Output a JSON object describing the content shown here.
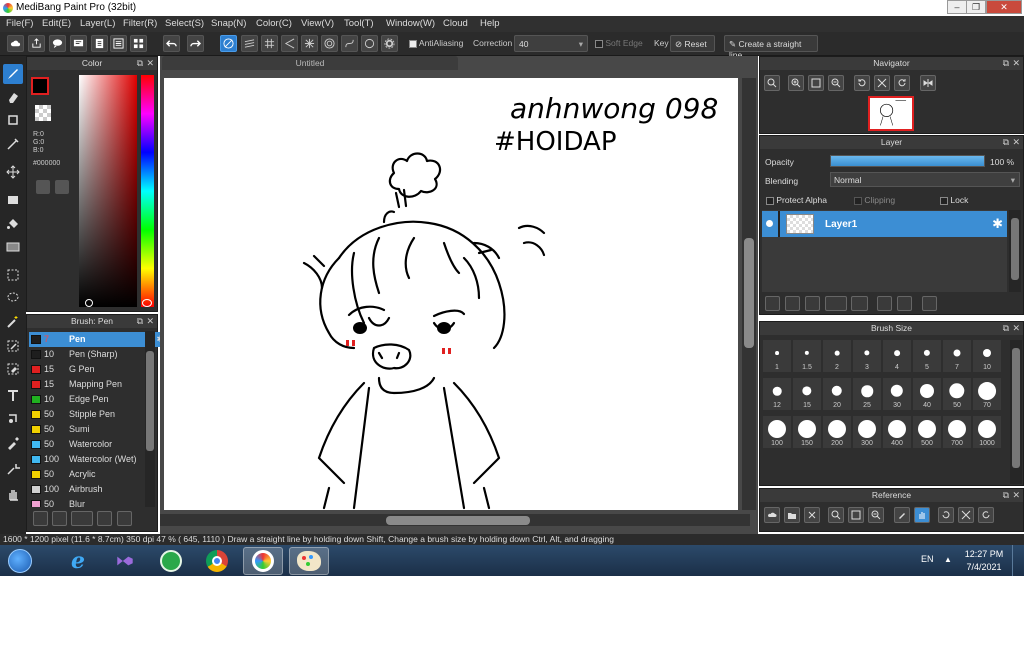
{
  "window": {
    "title": "MediBang Paint Pro (32bit)",
    "min": "–",
    "max": "❐",
    "close": "✕"
  },
  "menu": [
    "File(F)",
    "Edit(E)",
    "Layer(L)",
    "Filter(R)",
    "Select(S)",
    "Snap(N)",
    "Color(C)",
    "View(V)",
    "Tool(T)",
    "Window(W)",
    "Cloud",
    "Help"
  ],
  "toolbar": {
    "antialiasing": "AntiAliasing",
    "correction_label": "Correction",
    "correction_value": "40",
    "soft_edge": "Soft Edge",
    "key": "Key",
    "reset": "Reset",
    "straight_line": "Create a straight line"
  },
  "color_panel": {
    "title": "Color",
    "r": "R:0",
    "g": "G:0",
    "b": "B:0",
    "hex": "#000000",
    "primary_color": "#000000"
  },
  "brush_panel": {
    "title": "Brush: Pen",
    "items": [
      {
        "size": "7",
        "name": "Pen",
        "color": "#1e1e1e",
        "selected": true
      },
      {
        "size": "10",
        "name": "Pen (Sharp)",
        "color": "#1e1e1e"
      },
      {
        "size": "15",
        "name": "G Pen",
        "color": "#e02020"
      },
      {
        "size": "15",
        "name": "Mapping Pen",
        "color": "#e02020"
      },
      {
        "size": "10",
        "name": "Edge Pen",
        "color": "#20b020"
      },
      {
        "size": "50",
        "name": "Stipple Pen",
        "color": "#f0d000"
      },
      {
        "size": "50",
        "name": "Sumi",
        "color": "#f0d000"
      },
      {
        "size": "50",
        "name": "Watercolor",
        "color": "#40b8f0"
      },
      {
        "size": "100",
        "name": "Watercolor (Wet)",
        "color": "#40b8f0"
      },
      {
        "size": "50",
        "name": "Acrylic",
        "color": "#f0d000"
      },
      {
        "size": "100",
        "name": "Airbrush",
        "color": "#cfcfcf"
      },
      {
        "size": "50",
        "name": "Blur",
        "color": "#f0a0d0"
      }
    ]
  },
  "document": {
    "tab": "Untitled",
    "text_line1": "anhnwong 098",
    "text_line2": "#HOIDAP"
  },
  "navigator": {
    "title": "Navigator"
  },
  "layer_panel": {
    "title": "Layer",
    "opacity_label": "Opacity",
    "opacity_value": "100 %",
    "opacity_fraction": 1.0,
    "blending_label": "Blending",
    "blending_value": "Normal",
    "protect_alpha": "Protect Alpha",
    "clipping": "Clipping",
    "lock": "Lock",
    "layers": [
      {
        "name": "Layer1"
      }
    ]
  },
  "brush_size": {
    "title": "Brush Size",
    "sizes": [
      "1",
      "1.5",
      "2",
      "3",
      "4",
      "5",
      "7",
      "10",
      "12",
      "15",
      "20",
      "25",
      "30",
      "40",
      "50",
      "70",
      "100",
      "150",
      "200",
      "300",
      "400",
      "500",
      "700",
      "1000"
    ]
  },
  "reference": {
    "title": "Reference"
  },
  "status": {
    "text": "1600 * 1200 pixel  (11.6 * 8.7cm)  350 dpi  47 %  ( 645, 1110 )  Draw a straight line by holding down Shift, Change a brush size by holding down Ctrl, Alt, and dragging"
  },
  "taskbar": {
    "lang": "EN",
    "time": "12:27 PM",
    "date": "7/4/2021"
  }
}
